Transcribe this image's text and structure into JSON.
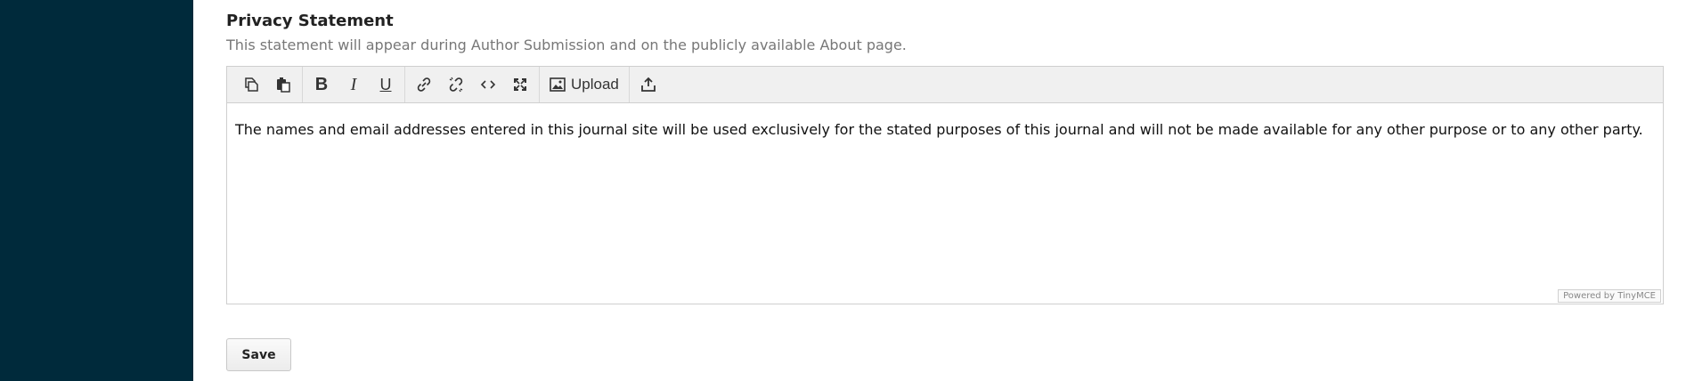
{
  "section": {
    "title": "Privacy Statement",
    "description": "This statement will appear during Author Submission and on the publicly available About page."
  },
  "toolbar": {
    "buttons": [
      {
        "icon": "copy-icon"
      },
      {
        "icon": "paste-icon"
      },
      {
        "icon": "bold-icon",
        "glyph": "B"
      },
      {
        "icon": "italic-icon",
        "glyph": "I"
      },
      {
        "icon": "underline-icon",
        "glyph": "U"
      },
      {
        "icon": "link-icon"
      },
      {
        "icon": "unlink-icon"
      },
      {
        "icon": "code-icon"
      },
      {
        "icon": "fullscreen-icon"
      },
      {
        "icon": "image-icon",
        "label": "Upload"
      },
      {
        "icon": "upload-icon"
      }
    ]
  },
  "editor": {
    "content": "The names and email addresses entered in this journal site will be used exclusively for the stated purposes of this journal and will not be made available for any other purpose or to any other party.",
    "powered_by": "Powered by TinyMCE"
  },
  "form": {
    "save_label": "Save"
  },
  "colors": {
    "sidebar": "#002a3b",
    "toolbar_bg": "#f0f0f0",
    "border": "#cfcfcf"
  }
}
